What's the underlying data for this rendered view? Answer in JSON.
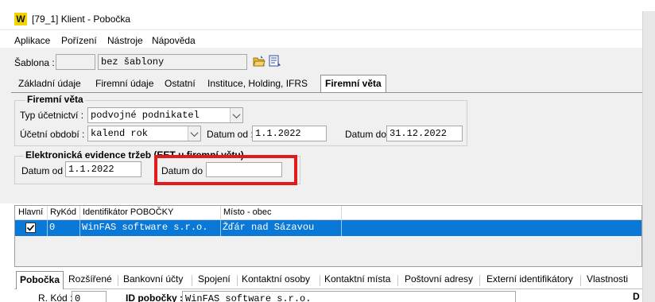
{
  "window": {
    "logo": "W",
    "title": "[79_1] Klient - Pobočka"
  },
  "menu": [
    "Aplikace",
    "Pořízení",
    "Nástroje",
    "Nápověda"
  ],
  "sablona": {
    "label": "Šablona :",
    "code": "",
    "name": "bez šablony"
  },
  "tabs_top": [
    {
      "label": "Základní údaje",
      "active": false
    },
    {
      "label": "Firemní údaje",
      "active": false
    },
    {
      "label": "Ostatní",
      "active": false
    },
    {
      "label": "Instituce, Holding, IFRS",
      "active": false
    },
    {
      "label": "Firemní věta",
      "active": true
    }
  ],
  "firemni_veta": {
    "group_title": "Firemní věta",
    "typ_ucetnictvi_label": "Typ účetnictví :",
    "typ_ucetnictvi_value": "podvojné podnikatel",
    "ucetni_obdobi_label": "Účetní období :",
    "ucetni_obdobi_value": "kalend rok",
    "datum_od_label": "Datum od :",
    "datum_od_value": "1.1.2022",
    "datum_do_label": "Datum do :",
    "datum_do_value": "31.12.2022"
  },
  "eet": {
    "group_title": "Elektronická evidence tržeb (EET u firemní větu)",
    "datum_od_label": "Datum od :",
    "datum_od_value": "1.1.2022",
    "datum_do_label": "Datum do :",
    "datum_do_value": ""
  },
  "grid": {
    "columns": [
      "Hlavní",
      "RyKód",
      "Identifikátor POBOČKY",
      "Místo - obec"
    ],
    "rows": [
      {
        "hlavni": true,
        "rykod": "0",
        "identifikator": "WinFAS software s.r.o.",
        "misto": "Žďár nad Sázavou"
      }
    ]
  },
  "tabs_bottom": [
    {
      "label": "Pobočka",
      "active": true
    },
    {
      "label": "Rozšířené",
      "active": false
    },
    {
      "label": "Bankovní účty",
      "active": false
    },
    {
      "label": "Spojení",
      "active": false
    },
    {
      "label": "Kontaktní osoby",
      "active": false
    },
    {
      "label": "Kontaktní místa",
      "active": false
    },
    {
      "label": "Poštovní adresy",
      "active": false
    },
    {
      "label": "Externí identifikátory",
      "active": false
    },
    {
      "label": "Vlastnosti",
      "active": false
    }
  ],
  "bottom_form": {
    "r_kod_label": "R. Kód :",
    "r_kod_value": "0",
    "id_pobocky_label": "ID pobočky :",
    "id_pobocky_value": "WinFAS software s.r.o.",
    "cut_label": "D"
  },
  "colors": {
    "selection": "#0a78d7",
    "highlight": "#e11b1b",
    "logo": "#f2d400"
  },
  "icons": [
    "open-folder-icon",
    "list-edit-icon"
  ]
}
